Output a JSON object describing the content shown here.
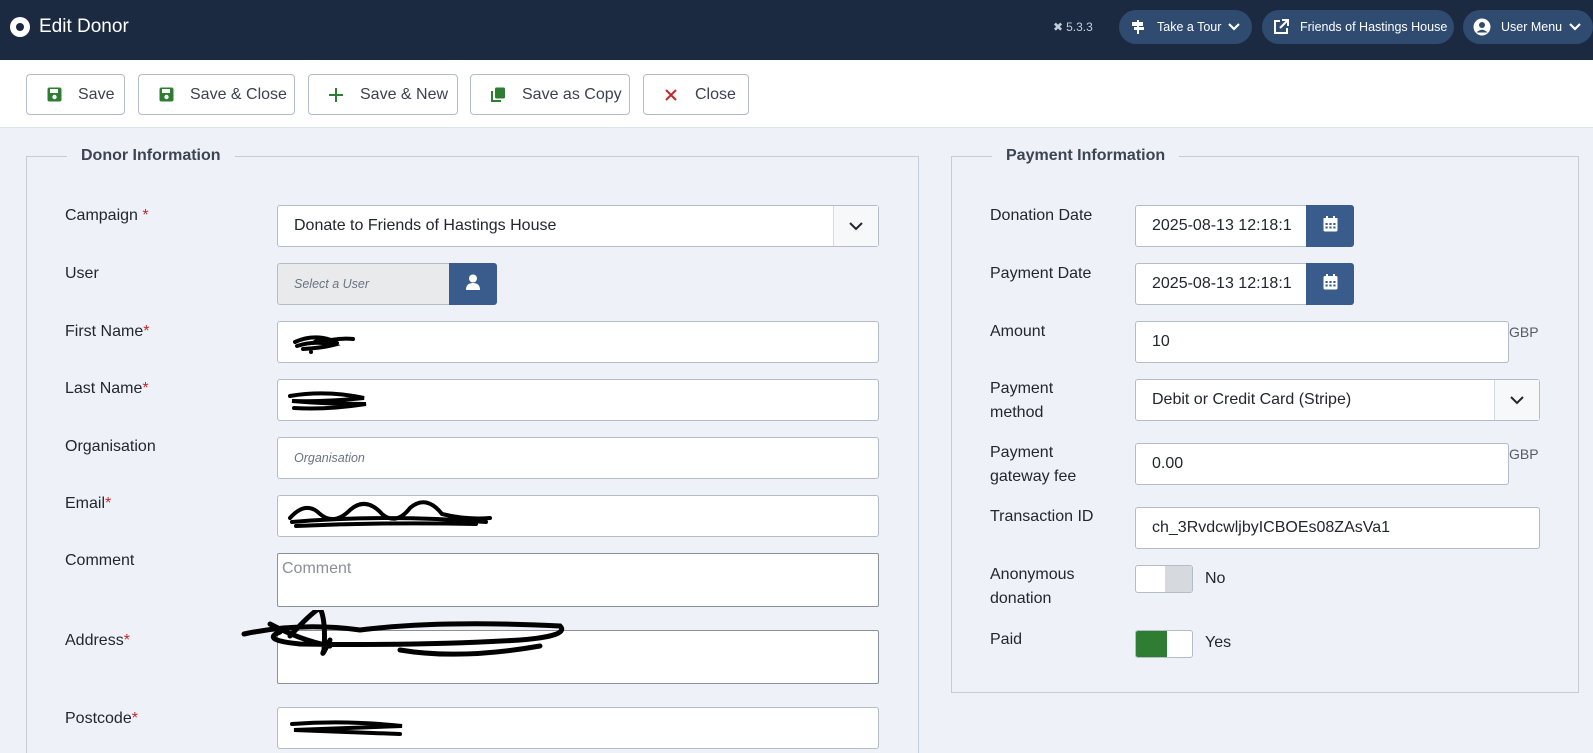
{
  "header": {
    "title": "Edit Donor",
    "version": "5.3.3",
    "take_tour": "Take a Tour",
    "site_link": "Friends of Hastings House",
    "user_menu": "User Menu"
  },
  "toolbar": {
    "save": "Save",
    "save_close": "Save & Close",
    "save_new": "Save & New",
    "save_copy": "Save as Copy",
    "close": "Close"
  },
  "donor": {
    "legend": "Donor Information",
    "campaign_label": "Campaign",
    "campaign_value": "Donate to Friends of Hastings House",
    "user_label": "User",
    "user_placeholder": "Select a User",
    "first_name_label": "First Name",
    "last_name_label": "Last Name",
    "organisation_label": "Organisation",
    "organisation_placeholder": "Organisation",
    "email_label": "Email",
    "comment_label": "Comment",
    "comment_placeholder": "Comment",
    "address_label": "Address",
    "postcode_label": "Postcode",
    "required_mark": "*"
  },
  "payment": {
    "legend": "Payment Information",
    "donation_date_label": "Donation Date",
    "donation_date_value": "2025-08-13 12:18:1",
    "payment_date_label": "Payment Date",
    "payment_date_value": "2025-08-13 12:18:1",
    "amount_label": "Amount",
    "amount_value": "10",
    "currency": "GBP",
    "method_label_1": "Payment",
    "method_label_2": "method",
    "method_value": "Debit or Credit Card (Stripe)",
    "fee_label_1": "Payment",
    "fee_label_2": "gateway fee",
    "fee_value": "0.00",
    "txn_label": "Transaction ID",
    "txn_value": "ch_3RvdcwljbyICBOEs08ZAsVa1",
    "anon_label_1": "Anonymous",
    "anon_label_2": "donation",
    "anon_value": "No",
    "paid_label": "Paid",
    "paid_value": "Yes"
  },
  "colors": {
    "header_bg": "#1c2a41",
    "accent_blue": "#3a5c8c",
    "toggle_on": "#2e7d32",
    "required": "#c52827"
  }
}
